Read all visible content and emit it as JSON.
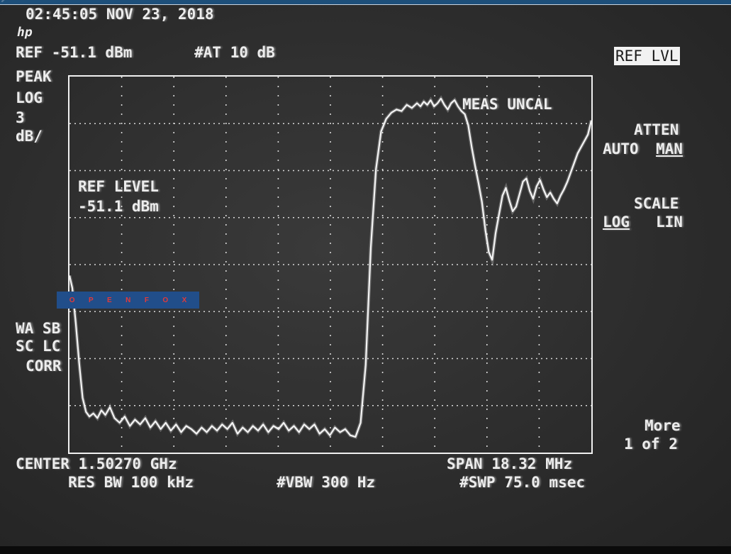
{
  "header": {
    "timestamp": "02:45:05 NOV 23, 2018",
    "logo": "hp",
    "ref_readout": "REF -51.1 dBm",
    "atten_readout": "#AT 10 dB"
  },
  "left_annotations": {
    "detector": "PEAK",
    "scale_type": "LOG",
    "scale_value": "3",
    "scale_unit": "dB/",
    "trace_a": "WA SB",
    "trace_b": "SC LC",
    "corr": "CORR"
  },
  "plot": {
    "warning": "MEAS UNCAL",
    "ref_label_line1": "REF LEVEL",
    "ref_label_line2": "-51.1 dBm"
  },
  "softkeys": {
    "active": "REF LVL",
    "atten_title": "ATTEN",
    "atten_auto": "AUTO",
    "atten_man": "MAN",
    "scale_title": "SCALE",
    "scale_log": "LOG",
    "scale_lin": "LIN",
    "more": "More",
    "page": "1 of 2"
  },
  "footer": {
    "center": "CENTER 1.50270 GHz",
    "span": "SPAN 18.32 MHz",
    "rbw": "RES BW 100 kHz",
    "vbw": "#VBW 300 Hz",
    "sweep": "#SWP 75.0 msec"
  },
  "watermark": {
    "letters": [
      "O",
      "P",
      "E",
      "N",
      "F",
      "O",
      "X"
    ]
  },
  "colors": {
    "trace": "#f4f4f4",
    "graticule": "#d8d8d8",
    "screen": "#2c2c2c",
    "watermark_bg": "#214e8a",
    "watermark_text": "#e13a3a"
  },
  "chart_data": {
    "type": "line",
    "title": "",
    "xlabel": "",
    "ylabel": "",
    "x_unit": "MHz",
    "y_unit": "dBm",
    "center_mhz": 1502.7,
    "span_mhz": 18.32,
    "xlim": [
      1493.54,
      1511.86
    ],
    "ylim": [
      -75.1,
      -51.1
    ],
    "y_divisions": 8,
    "x_divisions": 10,
    "grid": true,
    "series": [
      {
        "x": [
          1493.54,
          1493.64,
          1493.76,
          1493.88,
          1494.0,
          1494.12,
          1494.24,
          1494.38,
          1494.52,
          1494.66,
          1494.8,
          1494.96,
          1495.12,
          1495.3,
          1495.48,
          1495.66,
          1495.84,
          1496.02,
          1496.2,
          1496.38,
          1496.56,
          1496.74,
          1496.92,
          1497.1,
          1497.28,
          1497.46,
          1497.64,
          1497.82,
          1498.0,
          1498.18,
          1498.36,
          1498.54,
          1498.72,
          1498.9,
          1499.08,
          1499.26,
          1499.44,
          1499.62,
          1499.8,
          1499.98,
          1500.16,
          1500.34,
          1500.52,
          1500.7,
          1500.88,
          1501.06,
          1501.24,
          1501.42,
          1501.6,
          1501.78,
          1501.96,
          1502.14,
          1502.32,
          1502.5,
          1502.68,
          1502.86,
          1503.04,
          1503.22,
          1503.4,
          1503.58,
          1503.76,
          1503.94,
          1504.12,
          1504.3,
          1504.48,
          1504.66,
          1504.84,
          1505.02,
          1505.2,
          1505.38,
          1505.56,
          1505.74,
          1505.86,
          1505.98,
          1506.1,
          1506.22,
          1506.34,
          1506.46,
          1506.58,
          1506.7,
          1506.82,
          1506.94,
          1507.06,
          1507.18,
          1507.3,
          1507.42,
          1507.54,
          1507.66,
          1507.78,
          1507.9,
          1508.02,
          1508.14,
          1508.26,
          1508.38,
          1508.5,
          1508.62,
          1508.74,
          1508.86,
          1508.98,
          1509.1,
          1509.22,
          1509.34,
          1509.46,
          1509.58,
          1509.7,
          1509.82,
          1509.94,
          1510.06,
          1510.18,
          1510.3,
          1510.42,
          1510.54,
          1510.66,
          1510.78,
          1510.9,
          1511.02,
          1511.14,
          1511.26,
          1511.38,
          1511.5,
          1511.62,
          1511.74,
          1511.86
        ],
        "y": [
          -63.8,
          -64.6,
          -66.8,
          -69.4,
          -71.6,
          -72.5,
          -72.8,
          -72.6,
          -72.9,
          -72.4,
          -72.7,
          -72.2,
          -72.9,
          -73.2,
          -72.8,
          -73.4,
          -73.0,
          -73.3,
          -72.9,
          -73.5,
          -73.1,
          -73.6,
          -73.2,
          -73.7,
          -73.3,
          -73.8,
          -73.4,
          -73.6,
          -73.9,
          -73.5,
          -73.8,
          -73.4,
          -73.7,
          -73.3,
          -73.6,
          -73.2,
          -73.9,
          -73.5,
          -73.8,
          -73.4,
          -73.7,
          -73.3,
          -73.8,
          -73.4,
          -73.6,
          -73.2,
          -73.7,
          -73.4,
          -73.8,
          -73.3,
          -73.6,
          -73.3,
          -73.9,
          -73.6,
          -74.0,
          -73.5,
          -73.8,
          -73.6,
          -74.0,
          -74.1,
          -73.2,
          -69.5,
          -62.0,
          -57.0,
          -54.6,
          -53.8,
          -53.4,
          -53.2,
          -53.3,
          -52.9,
          -53.1,
          -52.8,
          -53.0,
          -52.7,
          -52.9,
          -52.6,
          -53.0,
          -52.8,
          -52.5,
          -52.9,
          -53.2,
          -52.8,
          -52.6,
          -53.0,
          -53.3,
          -53.5,
          -54.2,
          -55.6,
          -56.8,
          -57.9,
          -59.1,
          -60.9,
          -62.3,
          -62.8,
          -61.1,
          -59.9,
          -58.7,
          -58.2,
          -59.0,
          -59.7,
          -59.4,
          -58.6,
          -57.8,
          -57.6,
          -58.4,
          -58.9,
          -58.1,
          -57.7,
          -58.3,
          -58.8,
          -58.5,
          -58.9,
          -59.2,
          -58.7,
          -58.3,
          -57.8,
          -57.2,
          -56.6,
          -56.0,
          -55.6,
          -55.2,
          -54.8,
          -53.9
        ]
      }
    ],
    "annotations": [
      "MEAS UNCAL",
      "REF LEVEL -51.1 dBm"
    ]
  }
}
